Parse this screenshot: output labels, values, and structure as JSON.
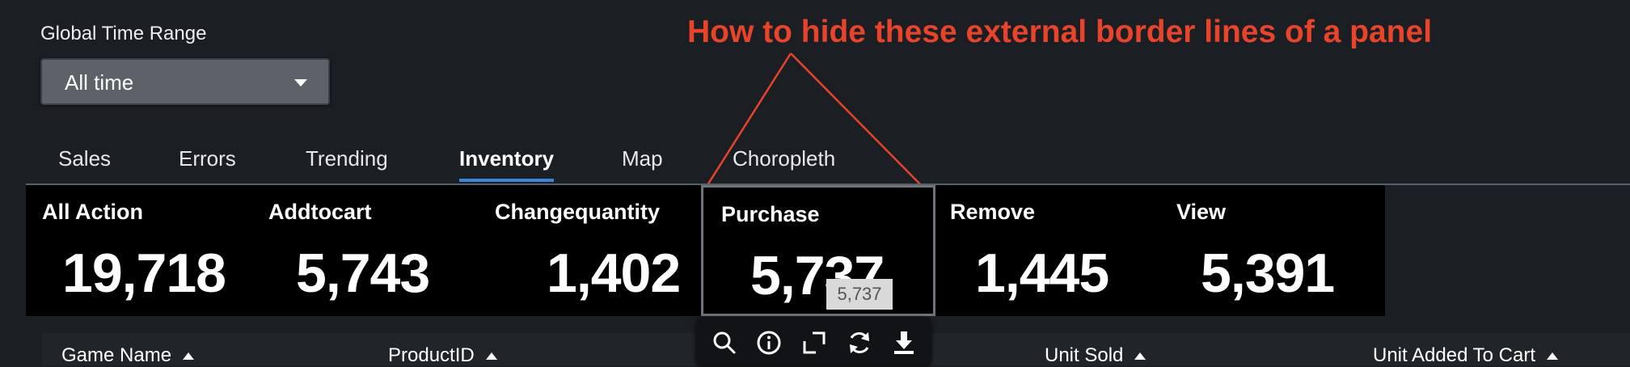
{
  "filter": {
    "label": "Global Time Range",
    "selected": "All time"
  },
  "annotation": {
    "text": "How to hide these external border lines of a panel"
  },
  "tabs": [
    {
      "label": "Sales",
      "active": false
    },
    {
      "label": "Errors",
      "active": false
    },
    {
      "label": "Trending",
      "active": false
    },
    {
      "label": "Inventory",
      "active": true
    },
    {
      "label": "Map",
      "active": false
    },
    {
      "label": "Choropleth",
      "active": false
    }
  ],
  "single_values": [
    {
      "title": "All Action",
      "value": "19,718"
    },
    {
      "title": "Addtocart",
      "value": "5,743"
    },
    {
      "title": "Changequantity",
      "value": "1,402"
    },
    {
      "title": "Purchase",
      "value": "5,737"
    },
    {
      "title": "Remove",
      "value": "1,445"
    },
    {
      "title": "View",
      "value": "5,391"
    }
  ],
  "tooltip": {
    "value": "5,737"
  },
  "toolbar": {
    "icons": [
      "search-icon",
      "info-icon",
      "expand-icon",
      "refresh-icon",
      "download-icon"
    ]
  },
  "table": {
    "headers": [
      "Game Name",
      "ProductID",
      "Unit Sold",
      "Unit Added To Cart"
    ]
  },
  "colors": {
    "annotation": "#e8432b",
    "active_tab": "#3c84d9",
    "background": "#1b1e22",
    "panel": "#000000"
  }
}
